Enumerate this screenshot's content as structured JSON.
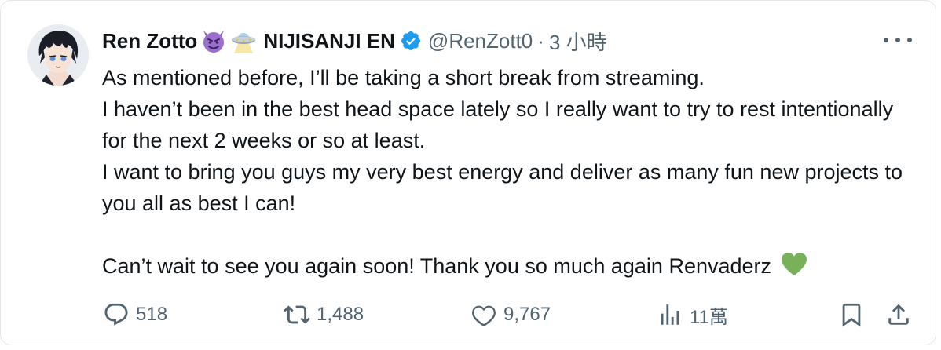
{
  "tweet": {
    "author": {
      "display_name": "Ren Zotto",
      "emoji_1": "smiling-imp-emoji",
      "emoji_2": "ufo-emoji",
      "org": "NIJISANJI EN",
      "handle": "@RenZott0",
      "separator": "·",
      "time": "3 小時"
    },
    "body": {
      "line_1": "As mentioned before, I’ll be taking a short break from streaming.",
      "line_2": "I haven’t been in the best head space lately so I really want to try to rest intentionally for the next 2 weeks or so at least.",
      "line_3": "I want to bring you guys my very best energy and deliver as many fun new projects to you all as best I can!",
      "line_4": "Can’t wait to see you again soon! Thank you so much again Renvaderz"
    },
    "stats": {
      "replies": "518",
      "retweets": "1,488",
      "likes": "9,767",
      "views": "11萬"
    },
    "icons": {
      "verified": "verified-badge-icon",
      "more": "more-options-icon",
      "heart": "green-heart-emoji"
    },
    "colors": {
      "verified_blue": "#1d9bf0",
      "secondary_text": "#536471",
      "primary_text": "#0f1419",
      "green_heart": "#78b159"
    }
  }
}
